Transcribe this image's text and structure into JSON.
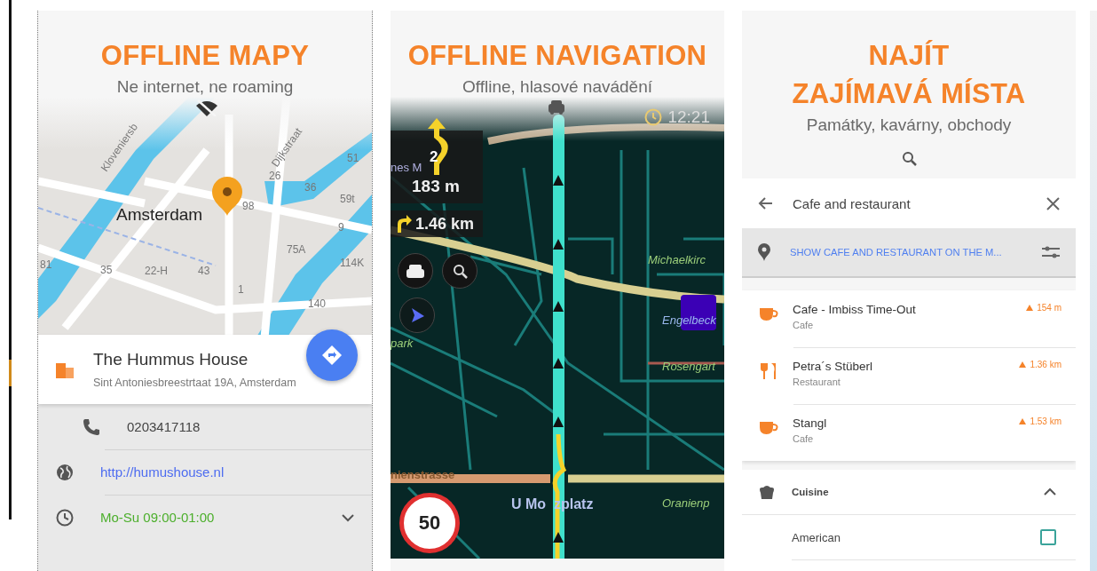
{
  "panels": [
    {
      "kind": "maps",
      "headline": [
        "OFFLINE MAPY"
      ],
      "subtitle": "Ne internet, ne roaming",
      "map_labels": [
        "Kloveniersb",
        "Dijkstraat",
        "51",
        "26",
        "36",
        "59t",
        "98",
        "Amsterdam",
        "9",
        "75A",
        "114K",
        "81",
        "35",
        "22-H",
        "43",
        "1",
        "140"
      ],
      "place": {
        "name": "The Hummus House",
        "address": "Sint Antoniesbreestrtaat 19A, Amsterdam"
      },
      "details": [
        {
          "kind": "phone",
          "text": "0203417118"
        },
        {
          "kind": "web",
          "text": "http://humushouse.nl"
        },
        {
          "kind": "hours",
          "text": "Mo-Su 09:00-01:00",
          "expanded": false
        }
      ]
    },
    {
      "kind": "navigation",
      "headline": [
        "OFFLINE NAVIGATION"
      ],
      "subtitle": "Offline, hlasové navádění",
      "clock": "12:21",
      "exit_number": "2",
      "turn_distance": "183 m",
      "next_turn_distance": "1.46 km",
      "speed_limit": "50",
      "map_labels": [
        "nes M",
        "Michaelkirc",
        "Engelbeck",
        "Rosengart",
        "nienstrasse",
        "U Mo",
        "zplatz",
        "Oranienp",
        "park"
      ]
    },
    {
      "kind": "search",
      "headline": [
        "NAJÍT",
        "ZAJÍMAVÁ MÍSTA"
      ],
      "subtitle": "Památky, kavárny, obchody",
      "search": {
        "value": "Cafe and restaurant"
      },
      "show_on_map": "SHOW CAFE AND RESTAURANT ON THE M...",
      "results": [
        {
          "kind": "cafe",
          "name": "Cafe - Imbiss Time-Out",
          "category": "Cafe",
          "distance": "154 m"
        },
        {
          "kind": "restaurant",
          "name": "Petra´s Stüberl",
          "category": "Restaurant",
          "distance": "1.36 km"
        },
        {
          "kind": "cafe",
          "name": "Stangl",
          "category": "Cafe",
          "distance": "1.53 km"
        }
      ],
      "filter": {
        "title": "Cuisine",
        "expanded": true,
        "options": [
          {
            "label": "American",
            "checked": false
          }
        ]
      }
    }
  ]
}
